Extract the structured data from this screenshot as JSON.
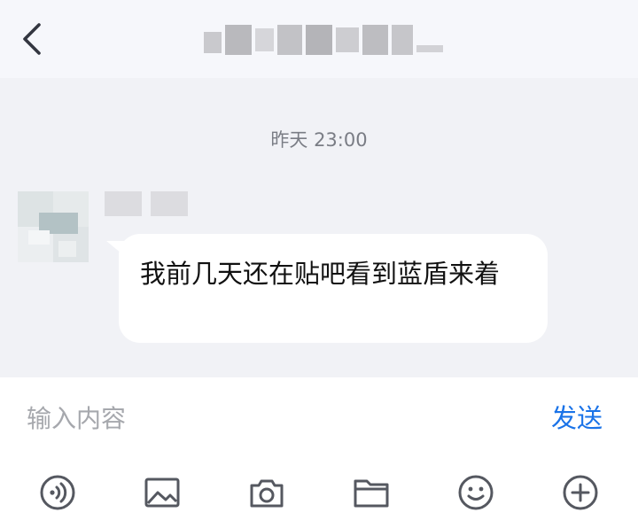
{
  "header": {
    "back_icon": "chevron-left-icon"
  },
  "chat": {
    "timestamp": "昨天 23:00",
    "messages": [
      {
        "text": "我前几天还在贴吧看到蓝盾来着"
      }
    ]
  },
  "composer": {
    "placeholder": "输入内容",
    "send_label": "发送",
    "tools": [
      "voice-icon",
      "image-icon",
      "camera-icon",
      "folder-icon",
      "emoji-icon",
      "add-icon"
    ]
  },
  "colors": {
    "accent": "#1a73e8",
    "icon": "#555860",
    "chat_bg": "#f1f2f6",
    "bubble_bg": "#ffffff"
  }
}
